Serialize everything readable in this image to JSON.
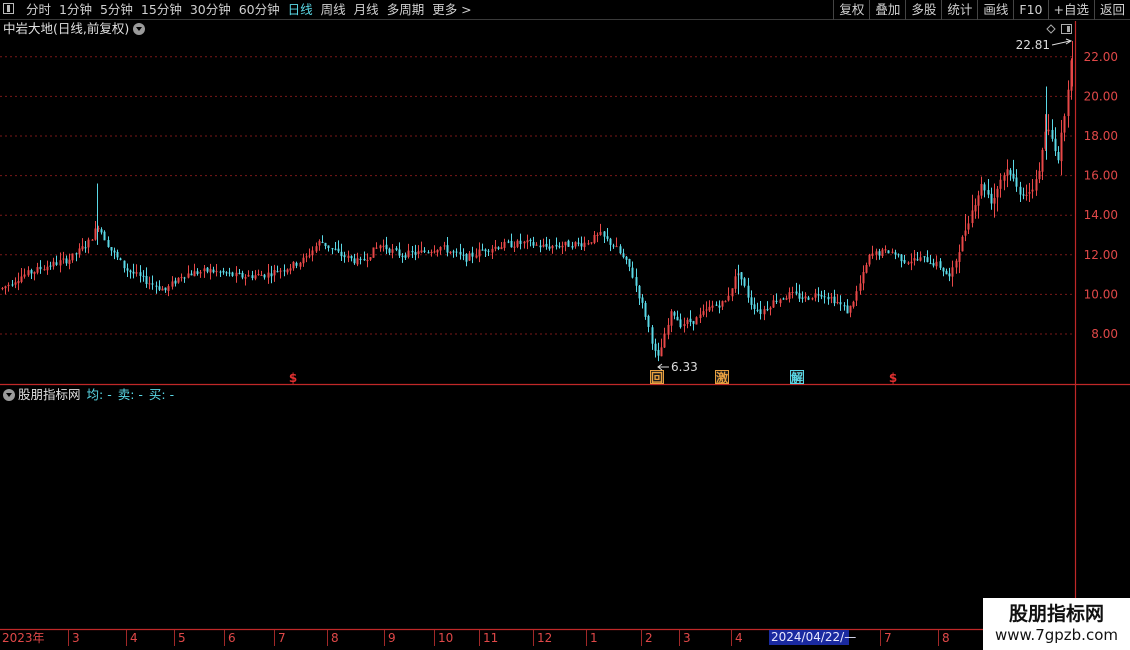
{
  "toolbar": {
    "periods": [
      {
        "label": "分时",
        "active": false
      },
      {
        "label": "1分钟",
        "active": false
      },
      {
        "label": "5分钟",
        "active": false
      },
      {
        "label": "15分钟",
        "active": false
      },
      {
        "label": "30分钟",
        "active": false
      },
      {
        "label": "60分钟",
        "active": false
      },
      {
        "label": "日线",
        "active": true
      },
      {
        "label": "周线",
        "active": false
      },
      {
        "label": "月线",
        "active": false
      },
      {
        "label": "多周期",
        "active": false
      },
      {
        "label": "更多 >",
        "active": false
      }
    ],
    "tools": [
      "复权",
      "叠加",
      "多股",
      "统计",
      "画线",
      "F10",
      "+自选",
      "返回"
    ]
  },
  "main_chart": {
    "title": "中岩大地(日线,前复权)",
    "price_axis": [
      "22.00",
      "20.00",
      "18.00",
      "16.00",
      "14.00",
      "12.00",
      "10.00",
      "8.00"
    ],
    "high_label": "22.81",
    "low_label": "6.33",
    "signals": [
      {
        "text": "$",
        "color": "#e03030"
      },
      {
        "text": "回",
        "color": "#e8a040"
      },
      {
        "text": "激",
        "color": "#e8a040"
      },
      {
        "text": "解",
        "color": "#5ad8e6"
      },
      {
        "text": "$",
        "color": "#e03030"
      }
    ]
  },
  "indicator": {
    "name": "股朋指标网",
    "fields": [
      "均: -",
      "卖: -",
      "买: -"
    ]
  },
  "date_axis": [
    "2023年",
    "3",
    "4",
    "5",
    "6",
    "7",
    "8",
    "9",
    "10",
    "11",
    "12",
    "1",
    "2",
    "3",
    "4",
    "7",
    "8"
  ],
  "cursor_date": "2024/04/22/—",
  "watermark": {
    "line1": "股朋指标网",
    "line2": "www.7gpzb.com"
  },
  "colors": {
    "up": "#e84848",
    "down": "#5ad8e6",
    "grid": "#7a1818",
    "axis": "#c02828"
  }
}
